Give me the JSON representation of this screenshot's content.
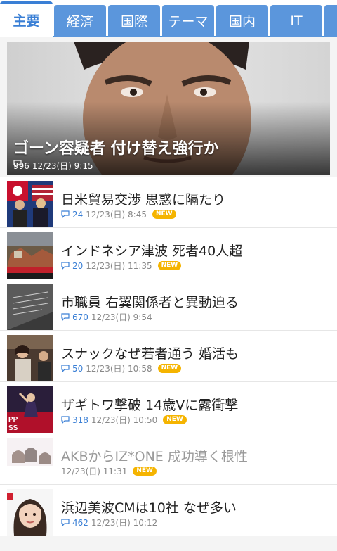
{
  "tabs": [
    {
      "label": "主要"
    },
    {
      "label": "経済"
    },
    {
      "label": "国際"
    },
    {
      "label": "テーマ"
    },
    {
      "label": "国内"
    },
    {
      "label": "IT"
    }
  ],
  "hero": {
    "title": "ゴーン容疑者 付け替え強行か",
    "comments": "996",
    "timestamp": "12/23(日) 9:15"
  },
  "articles": [
    {
      "title": "日米貿易交渉 思惑に隔たり",
      "comments": "24",
      "timestamp": "12/23(日) 8:45",
      "badge": "NEW"
    },
    {
      "title": "インドネシア津波 死者40人超",
      "comments": "20",
      "timestamp": "12/23(日) 11:35",
      "badge": "NEW"
    },
    {
      "title": "市職員 右翼関係者と異動迫る",
      "comments": "670",
      "timestamp": "12/23(日) 9:54",
      "badge": ""
    },
    {
      "title": "スナックなぜ若者通う 婚活も",
      "comments": "50",
      "timestamp": "12/23(日) 10:58",
      "badge": "NEW"
    },
    {
      "title": "ザギトワ撃破 14歳Vに露衝撃",
      "comments": "318",
      "timestamp": "12/23(日) 10:50",
      "badge": "NEW"
    },
    {
      "title": "AKBからIZ*ONE 成功導く根性",
      "comments": "",
      "timestamp": "12/23(日) 11:31",
      "badge": "NEW"
    },
    {
      "title": "浜辺美波CMは10社 なぜ多い",
      "comments": "462",
      "timestamp": "12/23(日) 10:12",
      "badge": ""
    }
  ],
  "colors": {
    "accent": "#3a7fd5",
    "tab_bg": "#5b96dc",
    "new_badge": "#f5b400"
  }
}
